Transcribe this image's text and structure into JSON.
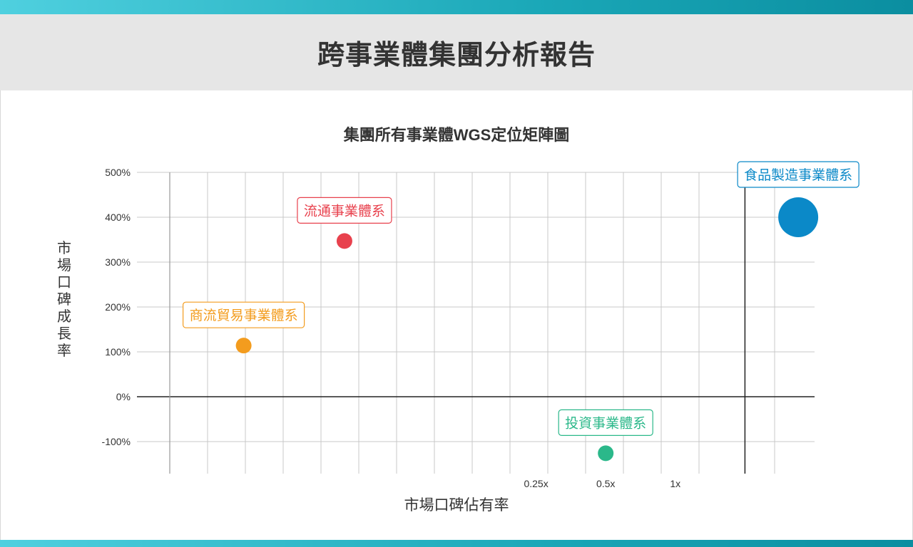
{
  "header": {
    "title": "跨事業體集團分析報告"
  },
  "chart_data": {
    "type": "scatter",
    "title": "集團所有事業體WGS定位矩陣圖",
    "xlabel": "市場口碑佔有率",
    "ylabel": "市場口碑成長率",
    "ylim": [
      -165,
      500
    ],
    "yticks": [
      500,
      400,
      300,
      200,
      100,
      0,
      -100
    ],
    "ytick_labels": [
      "500%",
      "400%",
      "300%",
      "200%",
      "100%",
      "0%",
      "-100%"
    ],
    "xticks": [
      0.25,
      0.5,
      1
    ],
    "xtick_labels": [
      "0.25x",
      "0.5x",
      "1x"
    ],
    "x_scale": "log",
    "xlim": [
      0.0047,
      4.0
    ],
    "divider_x": 2,
    "grid": true,
    "series": [
      {
        "name": "流通事業體系",
        "x": 0.0371,
        "y": 347,
        "size": "small",
        "color": "#e8414d"
      },
      {
        "name": "商流貿易事業體系",
        "x": 0.0136,
        "y": 114,
        "size": "small",
        "color": "#f39c1e"
      },
      {
        "name": "食品製造事業體系",
        "x": 3.4,
        "y": 400,
        "size": "large",
        "color": "#0b89c8"
      },
      {
        "name": "投資事業體系",
        "x": 0.5,
        "y": -126,
        "size": "small",
        "color": "#2bb88a"
      }
    ]
  }
}
